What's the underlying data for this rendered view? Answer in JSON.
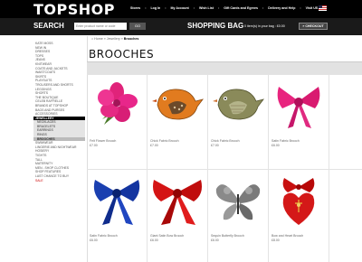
{
  "header": {
    "logo": "TOPSHOP",
    "nav": [
      "Stores",
      "Log In",
      "My Account",
      "Wish List",
      "Gift Cards and Egrves",
      "Delivery and Help",
      "Visit US Site"
    ],
    "nav_sep": "•"
  },
  "search": {
    "label": "SEARCH",
    "placeholder": "Enter product name or code",
    "go": "GO"
  },
  "bag": {
    "label": "SHOPPING BAG",
    "summary": "0 item(s) in your bag : £0.00",
    "checkout": "CHECKOUT"
  },
  "breadcrumb": {
    "home": "Home",
    "sep": "»",
    "category": "Jewellery",
    "current": "Brooches"
  },
  "page_title": "BROOCHES",
  "sidebar": {
    "top_items": [
      "KATE MOSS",
      "NEW IN",
      "DRESSES",
      "TOPS",
      "JEANS",
      "KNITWEAR",
      "COATS AND JACKETS",
      "WAISTCOATS",
      "SKIRTS",
      "PLAYSUITS",
      "TROUSERS AND SHORTS",
      "LEGGINGS",
      "SHORTS",
      "THE BOUTIQUE",
      "CELEB RAFFIELLE",
      "BRANDS AT TOPSHOP",
      "BAGS AND PURSES",
      "ACCESSORIES"
    ],
    "section": "JEWELLERY",
    "sub_items": [
      "NECKLACES",
      "BRACELETS",
      "EARRINGS",
      "RINGS",
      "BROOCHES"
    ],
    "active_sub": "BROOCHES",
    "bottom_items": [
      "SWIMWEAR",
      "LINGERIE AND NIGHTWEAR",
      "HOSIERY",
      "TIGHTS",
      "TALL",
      "MATERNITY",
      "MEN - SHOP CLOTHES",
      "SHOP FEATURES",
      "LAST CHANCE TO BUY"
    ],
    "sale": "SALE"
  },
  "products": [
    {
      "name": "Felt Flower Brooch",
      "price": "£7.00",
      "icon": "pink-flower-brooch"
    },
    {
      "name": "Chick Fabric Brooch",
      "price": "£7.00",
      "icon": "orange-bird-brooch"
    },
    {
      "name": "Chick Fabric Brooch",
      "price": "£7.00",
      "icon": "olive-bird-brooch"
    },
    {
      "name": "Satin Fabric Brooch",
      "price": "£6.00",
      "icon": "pink-satin-bow-brooch"
    },
    {
      "name": "Satin Fabric Brooch",
      "price": "£6.00",
      "icon": "blue-satin-bow-brooch"
    },
    {
      "name": "Giant Satin Bow Brooch",
      "price": "£6.00",
      "icon": "red-satin-bow-brooch"
    },
    {
      "name": "Sequin Butterfly Brooch",
      "price": "£6.00",
      "icon": "silver-butterfly-brooch"
    },
    {
      "name": "Bow and Heart Brooch",
      "price": "£8.00",
      "icon": "red-bow-heart-brooch"
    }
  ]
}
